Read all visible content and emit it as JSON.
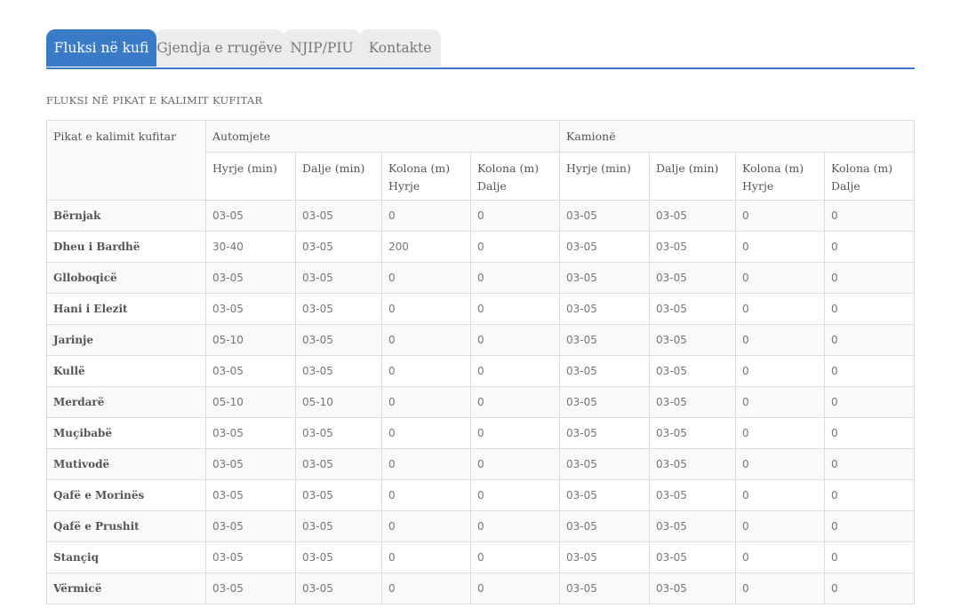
{
  "tabs": [
    {
      "label": "Fluksi në kufi",
      "active": true
    },
    {
      "label": "Gjendja e rrugëve",
      "active": false
    },
    {
      "label": "NJIP/PIU",
      "active": false
    },
    {
      "label": "Kontakte",
      "active": false
    }
  ],
  "section_title": "FLUKSI NË PIKAT E KALIMIT KUFITAR",
  "table": {
    "corner_header": "Pikat e kalimit kufitar",
    "groups": [
      "Automjete",
      "Kamionë"
    ],
    "subheaders": [
      "Hyrje (min)",
      "Dalje (min)",
      "Kolona (m) Hyrje",
      "Kolona (m) Dalje",
      "Hyrje (min)",
      "Dalje (min)",
      "Kolona (m) Hyrje",
      "Kolona (m) Dalje"
    ],
    "rows": [
      {
        "name": "Bërnjak",
        "cells": [
          "03-05",
          "03-05",
          "0",
          "0",
          "03-05",
          "03-05",
          "0",
          "0"
        ]
      },
      {
        "name": "Dheu i Bardhë",
        "cells": [
          "30-40",
          "03-05",
          "200",
          "0",
          "03-05",
          "03-05",
          "0",
          "0"
        ]
      },
      {
        "name": "Glloboqicë",
        "cells": [
          "03-05",
          "03-05",
          "0",
          "0",
          "03-05",
          "03-05",
          "0",
          "0"
        ]
      },
      {
        "name": "Hani i Elezit",
        "cells": [
          "03-05",
          "03-05",
          "0",
          "0",
          "03-05",
          "03-05",
          "0",
          "0"
        ]
      },
      {
        "name": "Jarinje",
        "cells": [
          "05-10",
          "03-05",
          "0",
          "0",
          "03-05",
          "03-05",
          "0",
          "0"
        ]
      },
      {
        "name": "Kullë",
        "cells": [
          "03-05",
          "03-05",
          "0",
          "0",
          "03-05",
          "03-05",
          "0",
          "0"
        ]
      },
      {
        "name": "Merdarë",
        "cells": [
          "05-10",
          "05-10",
          "0",
          "0",
          "03-05",
          "03-05",
          "0",
          "0"
        ]
      },
      {
        "name": "Muçibabë",
        "cells": [
          "03-05",
          "03-05",
          "0",
          "0",
          "03-05",
          "03-05",
          "0",
          "0"
        ]
      },
      {
        "name": "Mutivodë",
        "cells": [
          "03-05",
          "03-05",
          "0",
          "0",
          "03-05",
          "03-05",
          "0",
          "0"
        ]
      },
      {
        "name": "Qafë e Morinës",
        "cells": [
          "03-05",
          "03-05",
          "0",
          "0",
          "03-05",
          "03-05",
          "0",
          "0"
        ]
      },
      {
        "name": "Qafë e Prushit",
        "cells": [
          "03-05",
          "03-05",
          "0",
          "0",
          "03-05",
          "03-05",
          "0",
          "0"
        ]
      },
      {
        "name": "Stançiq",
        "cells": [
          "03-05",
          "03-05",
          "0",
          "0",
          "03-05",
          "03-05",
          "0",
          "0"
        ]
      },
      {
        "name": "Vërmicë",
        "cells": [
          "03-05",
          "03-05",
          "0",
          "0",
          "03-05",
          "03-05",
          "0",
          "0"
        ]
      }
    ]
  },
  "colors": {
    "accent": "#3a7bc8",
    "tab_inactive": "#ececec",
    "row_stripe": "#f9f9f9",
    "border": "#dddddd"
  }
}
